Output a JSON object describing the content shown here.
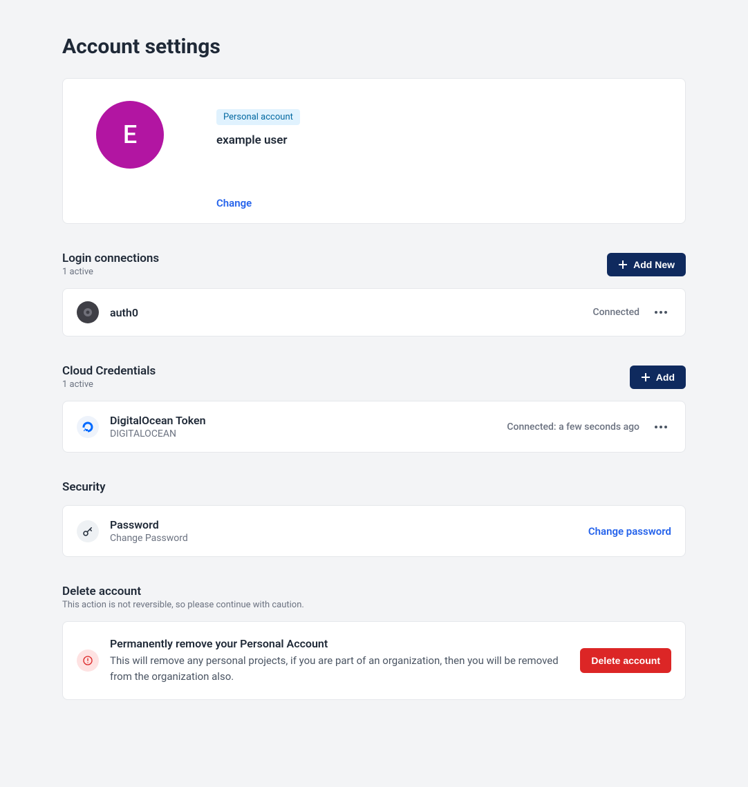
{
  "page_title": "Account settings",
  "profile": {
    "avatar_initial": "E",
    "badge": "Personal account",
    "username": "example user",
    "change": "Change"
  },
  "login_connections": {
    "title": "Login connections",
    "active_count": "1 active",
    "add_button": "Add New",
    "items": [
      {
        "name": "auth0",
        "status": "Connected"
      }
    ]
  },
  "cloud_credentials": {
    "title": "Cloud Credentials",
    "active_count": "1 active",
    "add_button": "Add",
    "items": [
      {
        "name": "DigitalOcean Token",
        "provider": "DIGITALOCEAN",
        "status": "Connected: a few seconds ago"
      }
    ]
  },
  "security": {
    "title": "Security",
    "password_title": "Password",
    "password_sub": "Change Password",
    "change_password": "Change password"
  },
  "delete": {
    "title": "Delete account",
    "subtitle": "This action is not reversible, so please continue with caution.",
    "warning_title": "Permanently remove your Personal Account",
    "warning_desc": "This will remove any personal projects, if you are part of an organization, then you will be removed from the organization also.",
    "button": "Delete account"
  }
}
